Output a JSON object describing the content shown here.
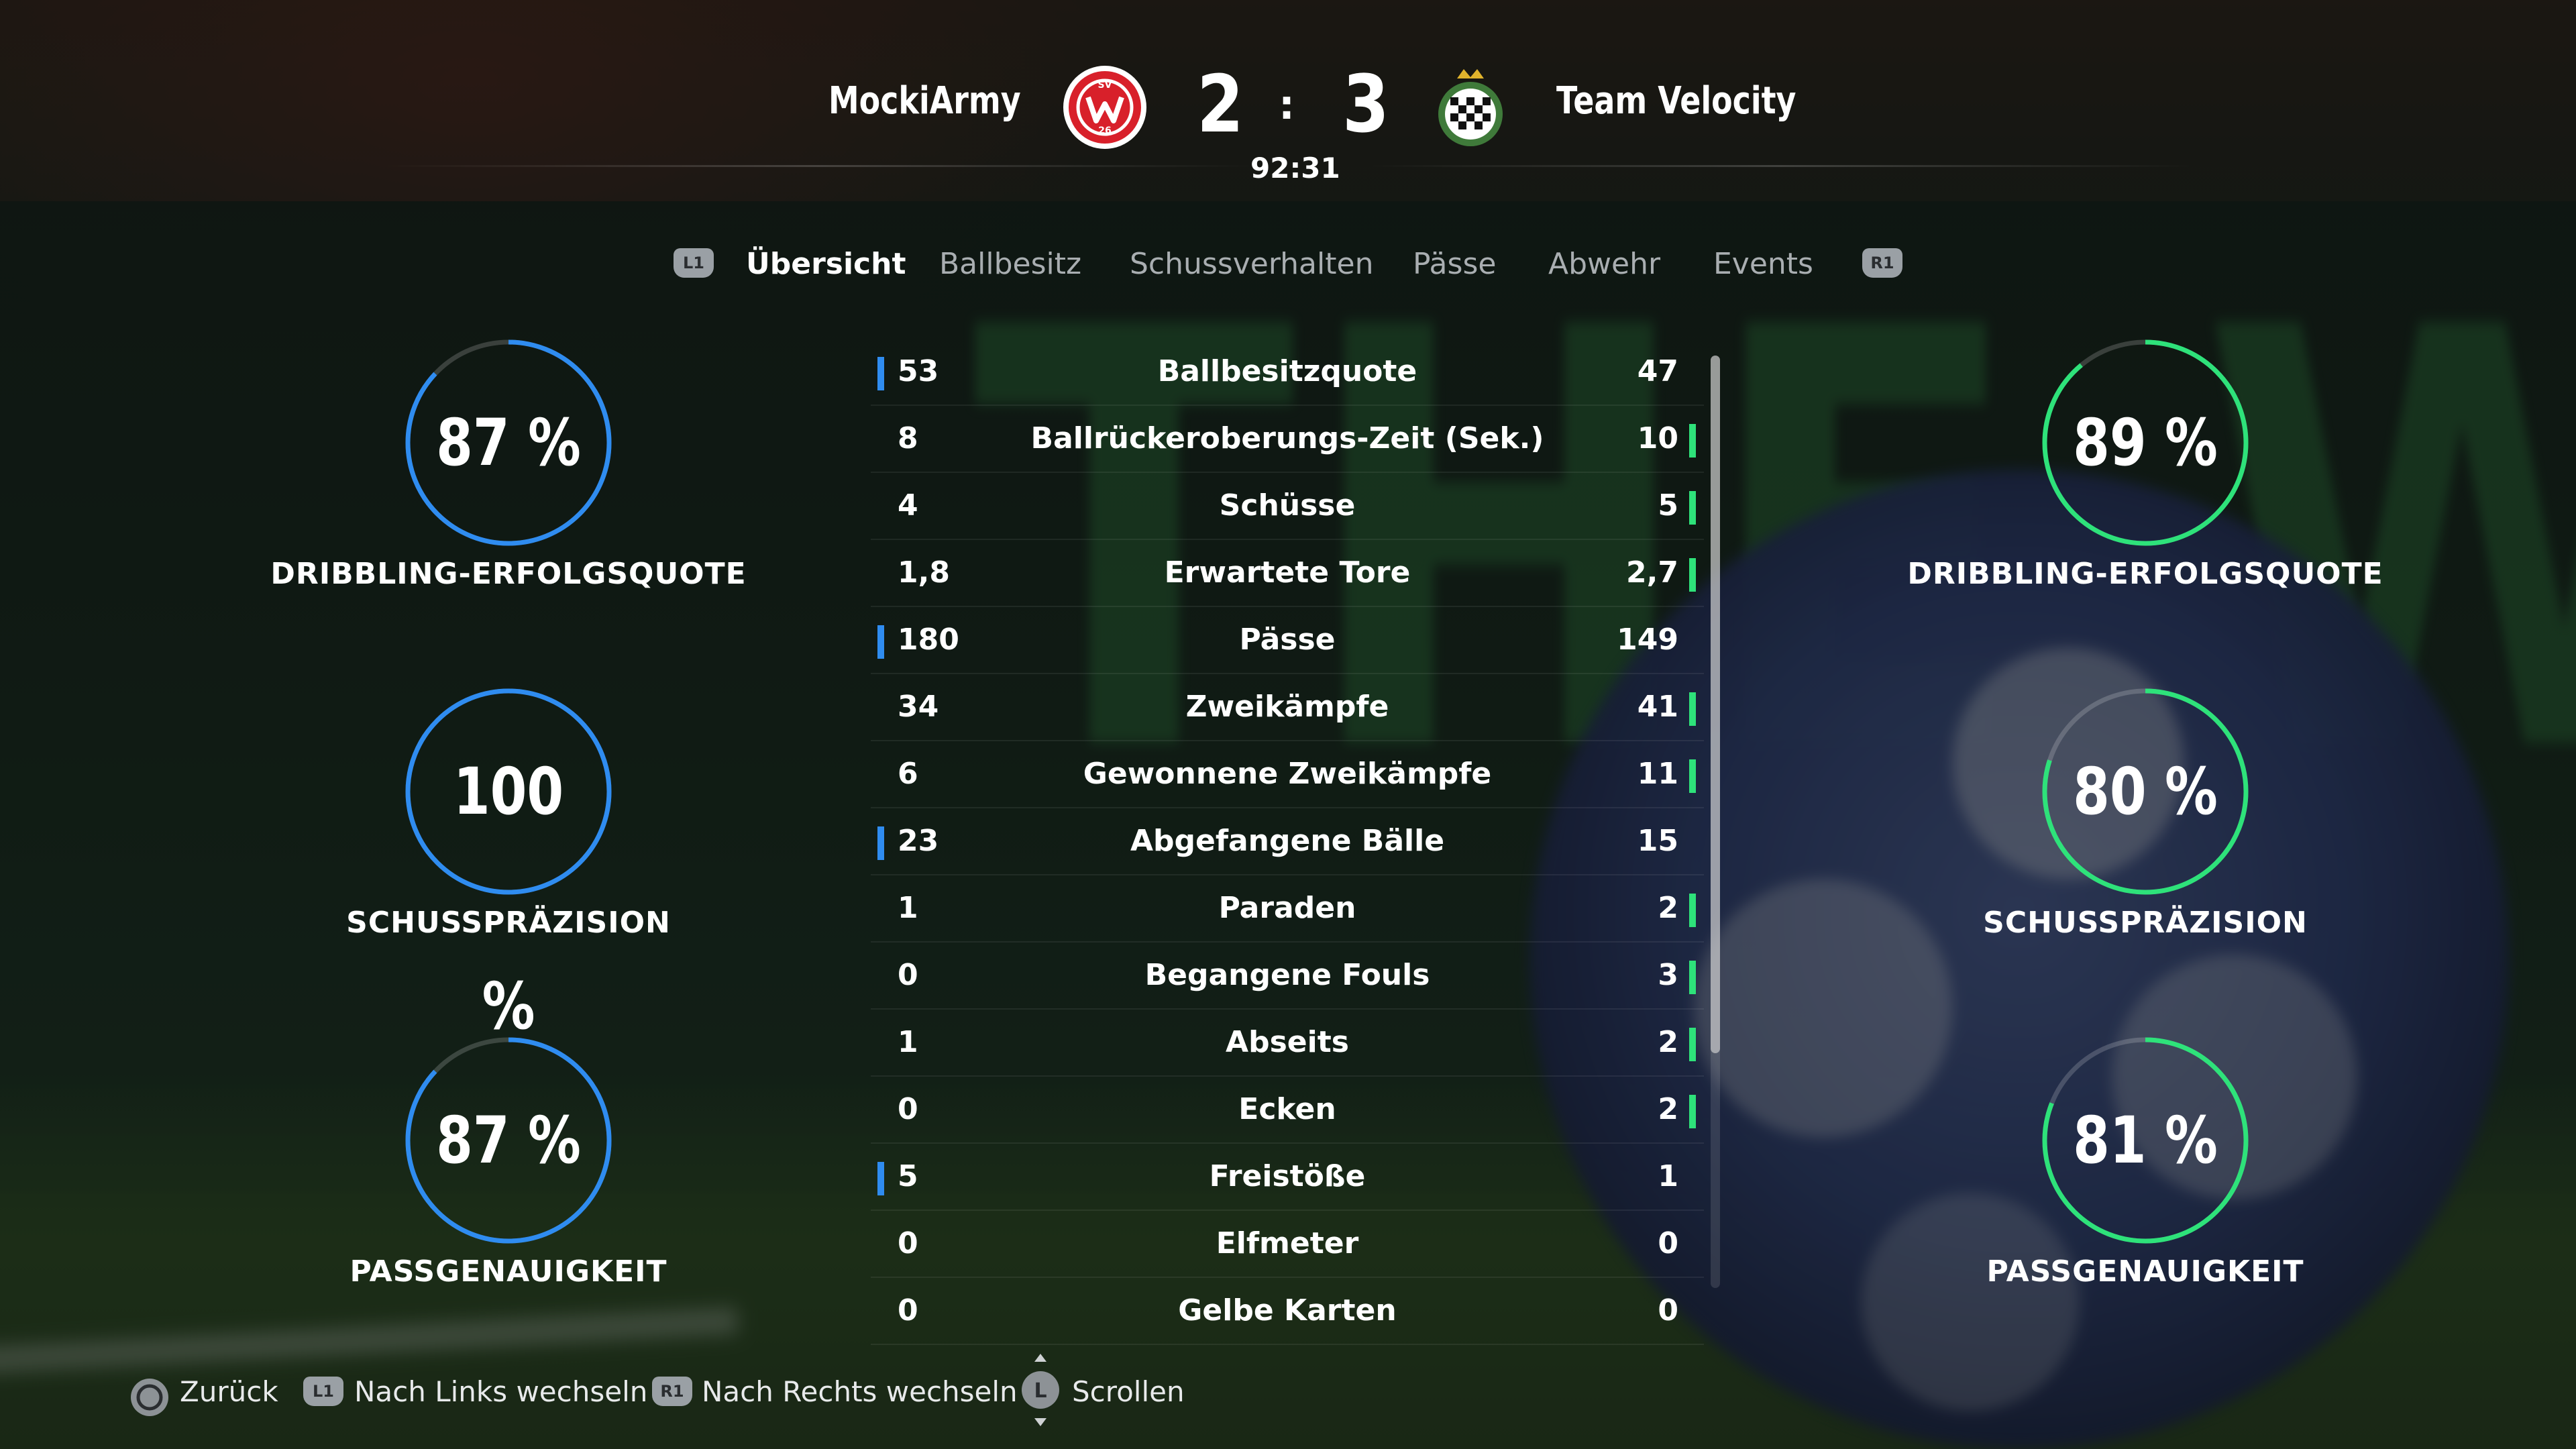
{
  "match": {
    "home_team": "MockiArmy",
    "away_team": "Team Velocity",
    "home_score": "2",
    "away_score": "3",
    "separator": ":",
    "clock": "92:31"
  },
  "tabs": {
    "left_hint": "L1",
    "right_hint": "R1",
    "items": [
      "Übersicht",
      "Ballbesitz",
      "Schussverhalten",
      "Pässe",
      "Abwehr",
      "Events"
    ],
    "active_index": 0
  },
  "gauges": {
    "home": [
      {
        "value": "87 %",
        "label": "DRIBBLING-ERFOLGSQUOTE",
        "fraction": 0.87
      },
      {
        "value": "100 %",
        "label": "SCHUSSPRÄZISION",
        "fraction": 1.0
      },
      {
        "value": "87 %",
        "label": "PASSGENAUIGKEIT",
        "fraction": 0.87
      }
    ],
    "away": [
      {
        "value": "89 %",
        "label": "DRIBBLING-ERFOLGSQUOTE",
        "fraction": 0.89
      },
      {
        "value": "80 %",
        "label": "SCHUSSPRÄZISION",
        "fraction": 0.8
      },
      {
        "value": "81 %",
        "label": "PASSGENAUIGKEIT",
        "fraction": 0.81
      }
    ],
    "home_color": "#2f8cf0",
    "away_color": "#2ee27a"
  },
  "stats": [
    {
      "name": "Ballbesitzquote",
      "home": "53",
      "away": "47",
      "leader": "home"
    },
    {
      "name": "Ballrückeroberungs-Zeit (Sek.)",
      "home": "8",
      "away": "10",
      "leader": "away"
    },
    {
      "name": "Schüsse",
      "home": "4",
      "away": "5",
      "leader": "away"
    },
    {
      "name": "Erwartete Tore",
      "home": "1,8",
      "away": "2,7",
      "leader": "away"
    },
    {
      "name": "Pässe",
      "home": "180",
      "away": "149",
      "leader": "home"
    },
    {
      "name": "Zweikämpfe",
      "home": "34",
      "away": "41",
      "leader": "away"
    },
    {
      "name": "Gewonnene Zweikämpfe",
      "home": "6",
      "away": "11",
      "leader": "away"
    },
    {
      "name": "Abgefangene Bälle",
      "home": "23",
      "away": "15",
      "leader": "home"
    },
    {
      "name": "Paraden",
      "home": "1",
      "away": "2",
      "leader": "away"
    },
    {
      "name": "Begangene Fouls",
      "home": "0",
      "away": "3",
      "leader": "away"
    },
    {
      "name": "Abseits",
      "home": "1",
      "away": "2",
      "leader": "away"
    },
    {
      "name": "Ecken",
      "home": "0",
      "away": "2",
      "leader": "away"
    },
    {
      "name": "Freistöße",
      "home": "5",
      "away": "1",
      "leader": "home"
    },
    {
      "name": "Elfmeter",
      "home": "0",
      "away": "0",
      "leader": "none"
    },
    {
      "name": "Gelbe Karten",
      "home": "0",
      "away": "0",
      "leader": "none"
    }
  ],
  "footer": {
    "back": "Zurück",
    "left": "Nach Links wechseln",
    "right": "Nach Rechts wechseln",
    "scroll": "Scrollen",
    "l1": "L1",
    "r1": "R1",
    "l_stick": "L"
  },
  "crests": {
    "home_text": "SV 26",
    "home_color": "#d8202a",
    "away_icon": "checkered-crest-icon"
  },
  "background_text": "THE WOR"
}
